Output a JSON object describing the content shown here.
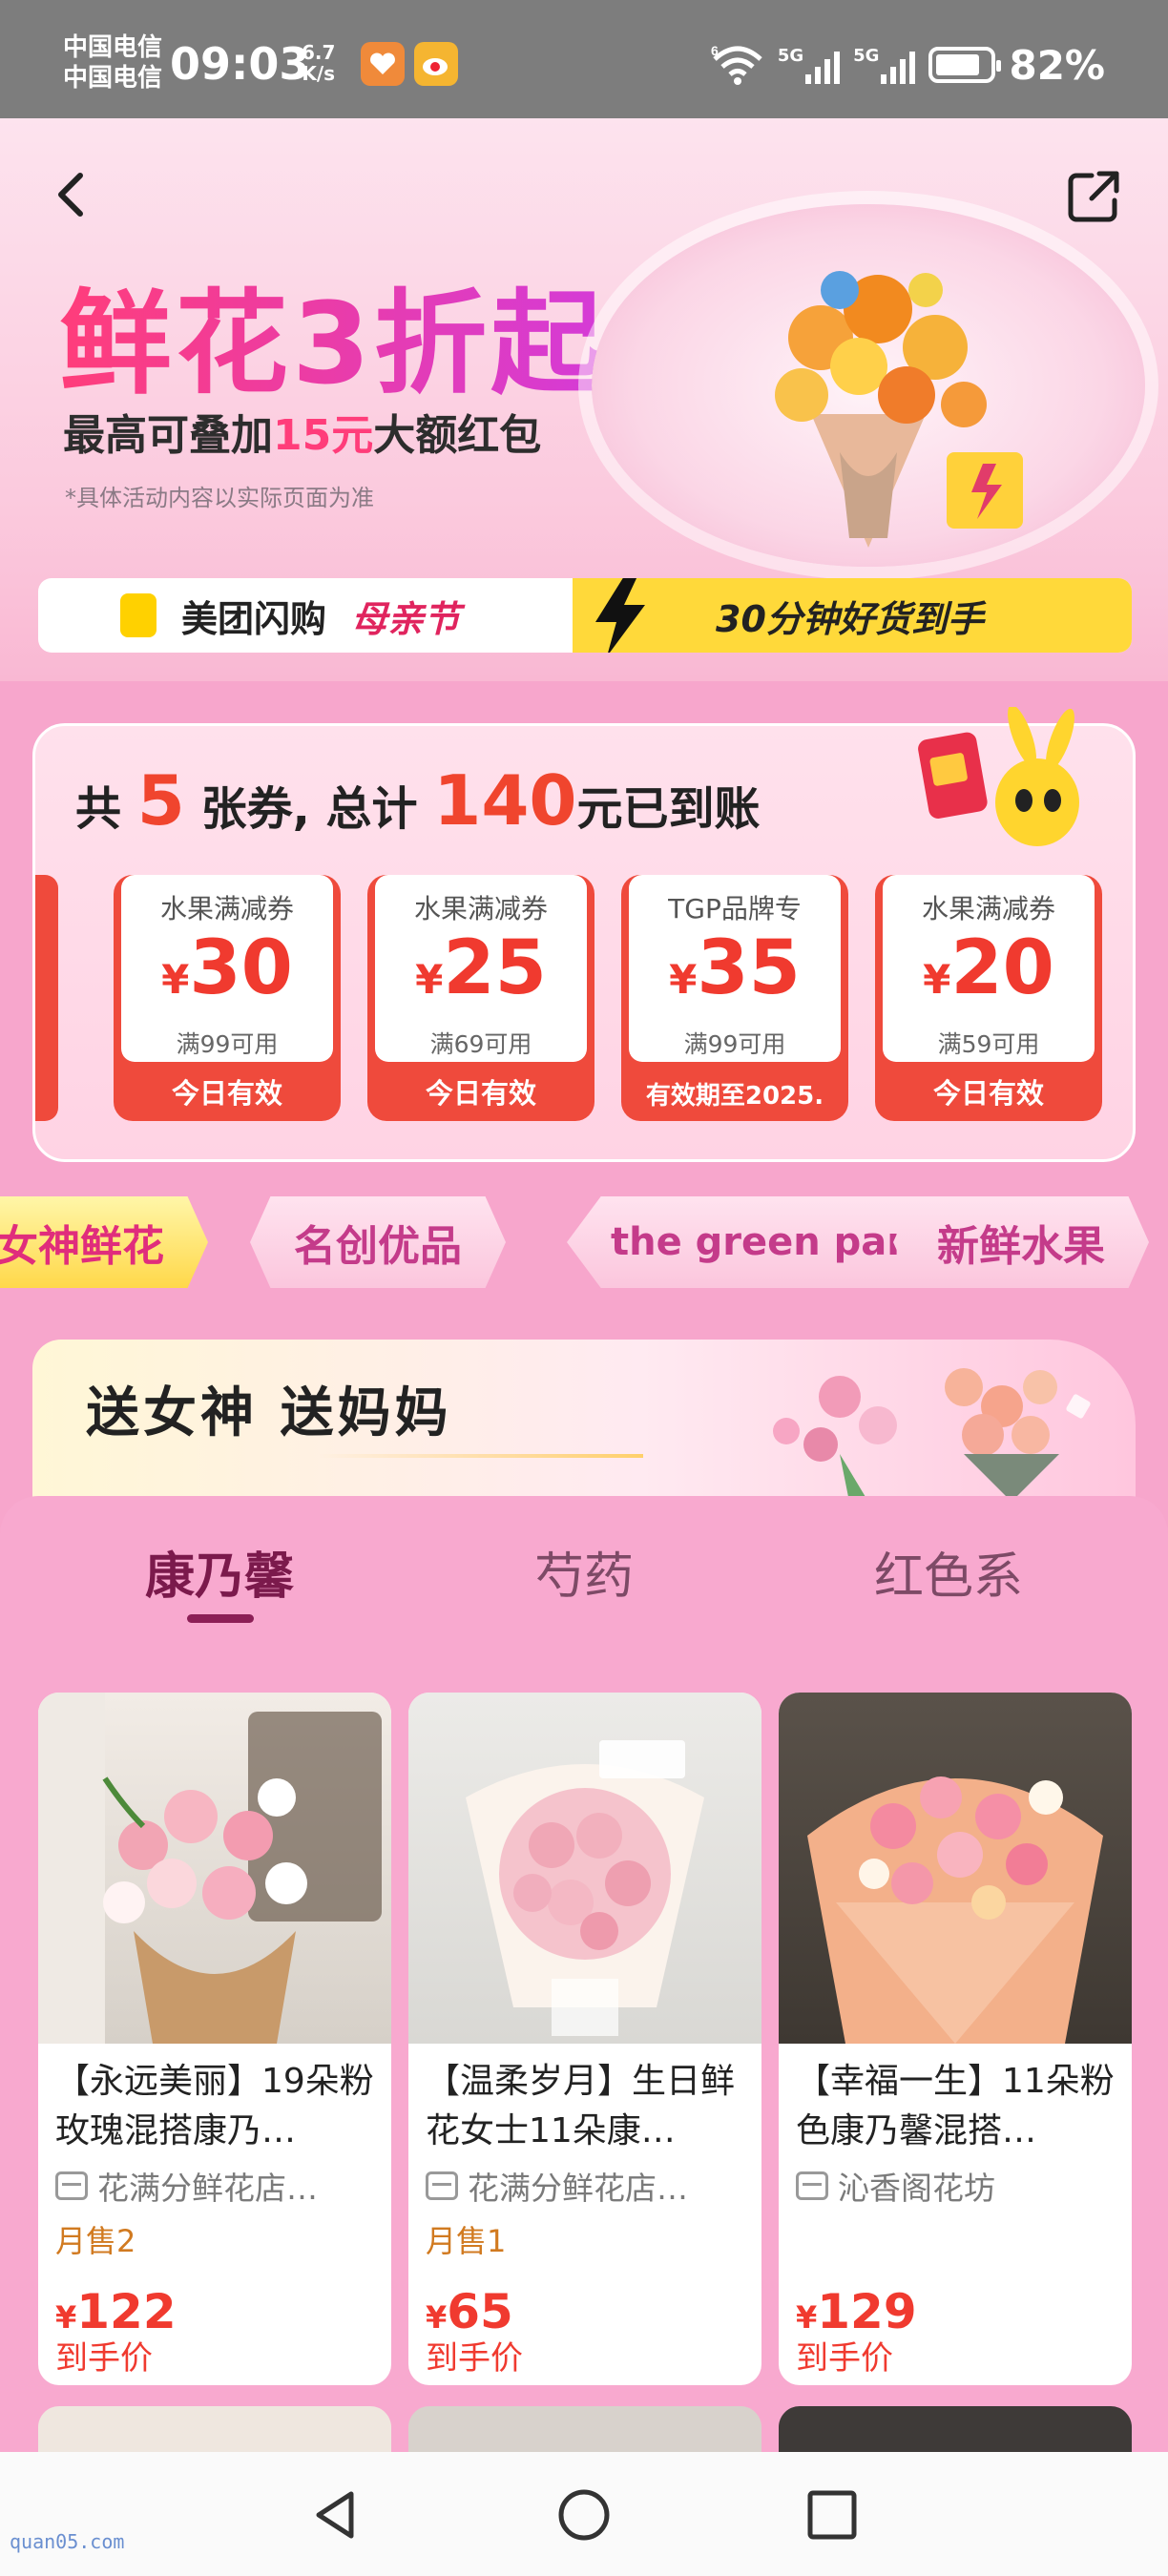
{
  "status_bar": {
    "carrier_1": "中国电信",
    "carrier_2": "中国电信",
    "time": "09:03",
    "speed_value": "6.7",
    "speed_unit": "K/s",
    "battery": "82%",
    "battery_level": 0.82,
    "network_1": "5G",
    "network_2": "5G",
    "wifi_label": "6"
  },
  "banner": {
    "headline": "鲜花3折起",
    "subline_pre": "最高可叠加",
    "subline_hl": "15元",
    "subline_post": "大额红包",
    "note": "*具体活动内容以实际页面为准",
    "brand": "美团闪购",
    "event": "母亲节",
    "slogan": "30分钟好货到手"
  },
  "coupons": {
    "title_pre": "共",
    "count": "5",
    "title_mid": "张券, 总计",
    "total": "140",
    "title_post": "元已到账",
    "items": [
      {
        "type": "水果满减券",
        "currency": "¥",
        "amount": "30",
        "cond": "满99可用",
        "valid": "今日有效"
      },
      {
        "type": "水果满减券",
        "currency": "¥",
        "amount": "25",
        "cond": "满69可用",
        "valid": "今日有效"
      },
      {
        "type": "TGP品牌专",
        "currency": "¥",
        "amount": "35",
        "cond": "满99可用",
        "valid": "有效期至2025."
      },
      {
        "type": "水果满减券",
        "currency": "¥",
        "amount": "20",
        "cond": "满59可用",
        "valid": "今日有效"
      }
    ]
  },
  "pills": [
    "女神鲜花",
    "名创优品",
    "the green party",
    "新鲜水果"
  ],
  "gift_banner": {
    "title": "送女神 送妈妈"
  },
  "tabs": [
    "康乃馨",
    "芍药",
    "红色系"
  ],
  "products": [
    {
      "title": "【永远美丽】19朵粉玫瑰混搭康乃…",
      "shop": "花满分鲜花店…",
      "sold": "月售2",
      "currency": "¥",
      "price": "122",
      "label": "到手价"
    },
    {
      "title": "【温柔岁月】生日鲜花女士11朵康…",
      "shop": "花满分鲜花店…",
      "sold": "月售1",
      "currency": "¥",
      "price": "65",
      "label": "到手价"
    },
    {
      "title": "【幸福一生】11朵粉色康乃馨混搭…",
      "shop": "沁香阁花坊",
      "sold": "",
      "currency": "¥",
      "price": "129",
      "label": "到手价"
    }
  ],
  "watermark": "quan05.com",
  "colors": {
    "accent": "#f03a2f",
    "pink": "#f8a9cf",
    "brand_yellow": "#ffd93a",
    "tab_active": "#7b1a4c"
  }
}
